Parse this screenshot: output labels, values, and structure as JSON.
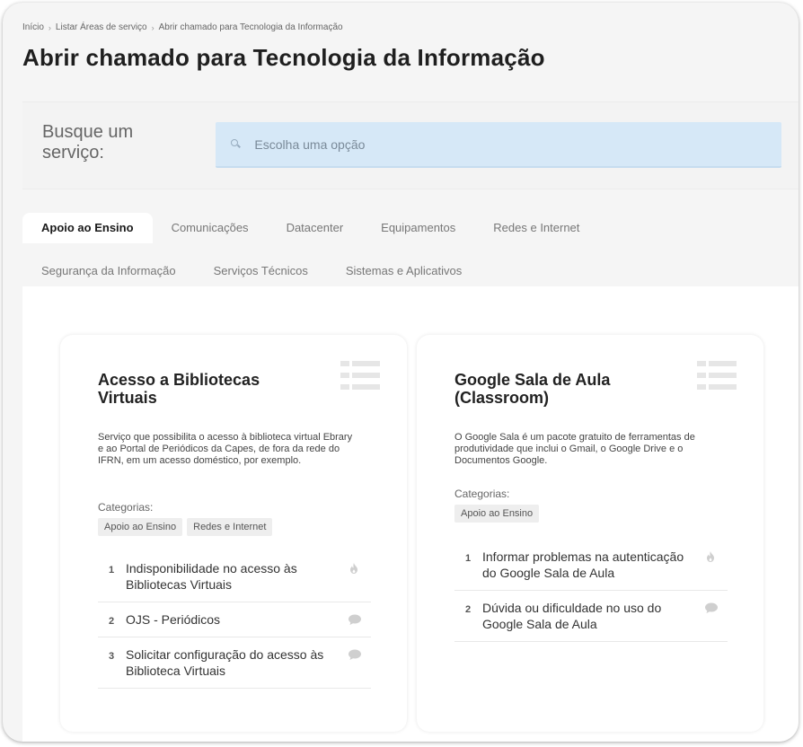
{
  "breadcrumb": {
    "items": [
      "Início",
      "Listar Áreas de serviço",
      "Abrir chamado para Tecnologia da Informação"
    ]
  },
  "page": {
    "title": "Abrir chamado para Tecnologia da Informação"
  },
  "search": {
    "label": "Busque um serviço:",
    "placeholder": "Escolha uma opção"
  },
  "tabs": [
    {
      "label": "Apoio ao Ensino",
      "active": true
    },
    {
      "label": "Comunicações"
    },
    {
      "label": "Datacenter"
    },
    {
      "label": "Equipamentos"
    },
    {
      "label": "Redes e Internet"
    },
    {
      "label": "Segurança da Informação"
    },
    {
      "label": "Serviços Técnicos"
    },
    {
      "label": "Sistemas e Aplicativos"
    }
  ],
  "cards": [
    {
      "title": "Acesso a Bibliotecas Virtuais",
      "icon": "list-icon",
      "description": "Serviço que possibilita o acesso à biblioteca virtual Ebrary e ao Portal de Periódicos da Capes, de fora da rede do IFRN, em um acesso doméstico, por exemplo.",
      "categories_label": "Categorias:",
      "categories": [
        "Apoio ao Ensino",
        "Redes e Internet"
      ],
      "services": [
        {
          "num": "1",
          "label": "Indisponibilidade no acesso às Bibliotecas Virtuais",
          "icon": "flame-icon"
        },
        {
          "num": "2",
          "label": "OJS - Periódicos",
          "icon": "chat-icon"
        },
        {
          "num": "3",
          "label": "Solicitar configuração do acesso às Biblioteca Virtuais",
          "icon": "chat-icon"
        }
      ]
    },
    {
      "title": "Google Sala de Aula (Classroom)",
      "icon": "list-icon",
      "description": "O Google Sala é um pacote gratuito de ferramentas de produtividade que inclui o Gmail, o Google Drive e o Documentos Google.",
      "categories_label": "Categorias:",
      "categories": [
        "Apoio ao Ensino"
      ],
      "services": [
        {
          "num": "1",
          "label": "Informar problemas na autenticação do Google Sala de Aula",
          "icon": "flame-icon"
        },
        {
          "num": "2",
          "label": "Dúvida ou dificuldade no uso do Google Sala de Aula",
          "icon": "chat-icon"
        }
      ]
    }
  ],
  "colors": {
    "search_bg": "#d6e8f7",
    "page_bg": "#f5f5f5",
    "icon_gray": "#cfcfcf"
  }
}
